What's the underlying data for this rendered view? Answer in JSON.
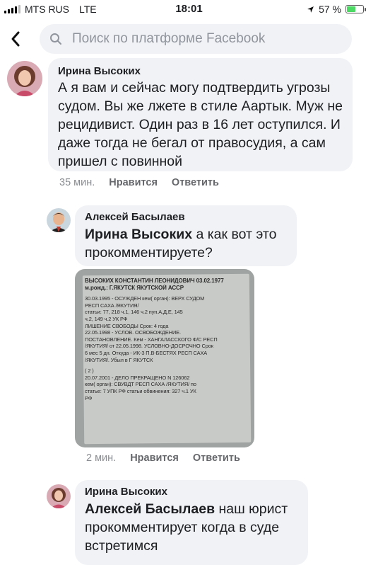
{
  "status_bar": {
    "carrier": "MTS RUS",
    "network": "LTE",
    "time": "18:01",
    "battery_percent": 57,
    "battery_label": "57 %"
  },
  "header": {
    "search_placeholder": "Поиск по платформе Facebook"
  },
  "comments": [
    {
      "author": "Ирина Высоких",
      "text": "А я вам и сейчас могу подтвердить угрозы судом. Вы же лжете в стиле Аартык. Муж не рецидивист. Один раз в 16 лет оступился. И даже тогда не бегал от правосудия, а сам пришел с повинной",
      "time": "35 мин.",
      "like": "Нравится",
      "reply": "Ответить"
    },
    {
      "author": "Алексей Басылаев",
      "mention": "Ирина Высоких",
      "text": " а как вот это прокомментируете?",
      "time": "2 мин.",
      "like": "Нравится",
      "reply": "Ответить",
      "attachment_lines": [
        "ВЫСОКИХ КОНСТАНТИН ЛЕОНИДОВИЧ 03.02.1977",
        "м.рожд.: Г.ЯКУТСК ЯКУТСКОЙ АССР",
        "",
        "30.03.1995 - ОСУЖДЕН кем( орган): ВЕРХ СУДОМ",
        "РЕСП САХА /ЯКУТИЯ/",
        "статьи: 77, 218 ч.1, 146 ч.2 пун.А,Д,Е, 145",
        "ч.2, 149 ч.2 УК РФ",
        "ЛИШЕНИЕ СВОБОДЫ Срок: 4 года",
        "22.05.1998 - УСЛОВ. ОСВОБОЖДЕНИЕ.",
        "ПОСТАНОВЛЕНИЕ. Кем - ХАНГАЛАССКОГО Ф/С РЕСП",
        "/ЯКУТИЯ/ от 22.05.1998. УСЛОВНО-ДОСРОЧНО Срок",
        "6 мес 5 дн. Откуда - ИК-3 П.В-БЕСТЯХ РЕСП САХА",
        "/ЯКУТИЯ/. Убыл в Г ЯКУТСК",
        "",
        "( 2 )",
        "20.07.2001 - ДЕЛО ПРЕКРАЩЕНО N 126062",
        "кем( орган): СВУВДТ РЕСП САХА /ЯКУТИЯ/ по",
        "статье: 7 УПК РФ статьи обвинения: 327 ч.1 УК",
        "РФ"
      ]
    },
    {
      "author": "Ирина Высоких",
      "mention": "Алексей Басылаев",
      "text": " наш юрист прокомментирует когда в суде встретимся"
    }
  ],
  "colors": {
    "bubble": "#f0f2f5",
    "meta": "#65676b",
    "battery": "#4cd964"
  }
}
